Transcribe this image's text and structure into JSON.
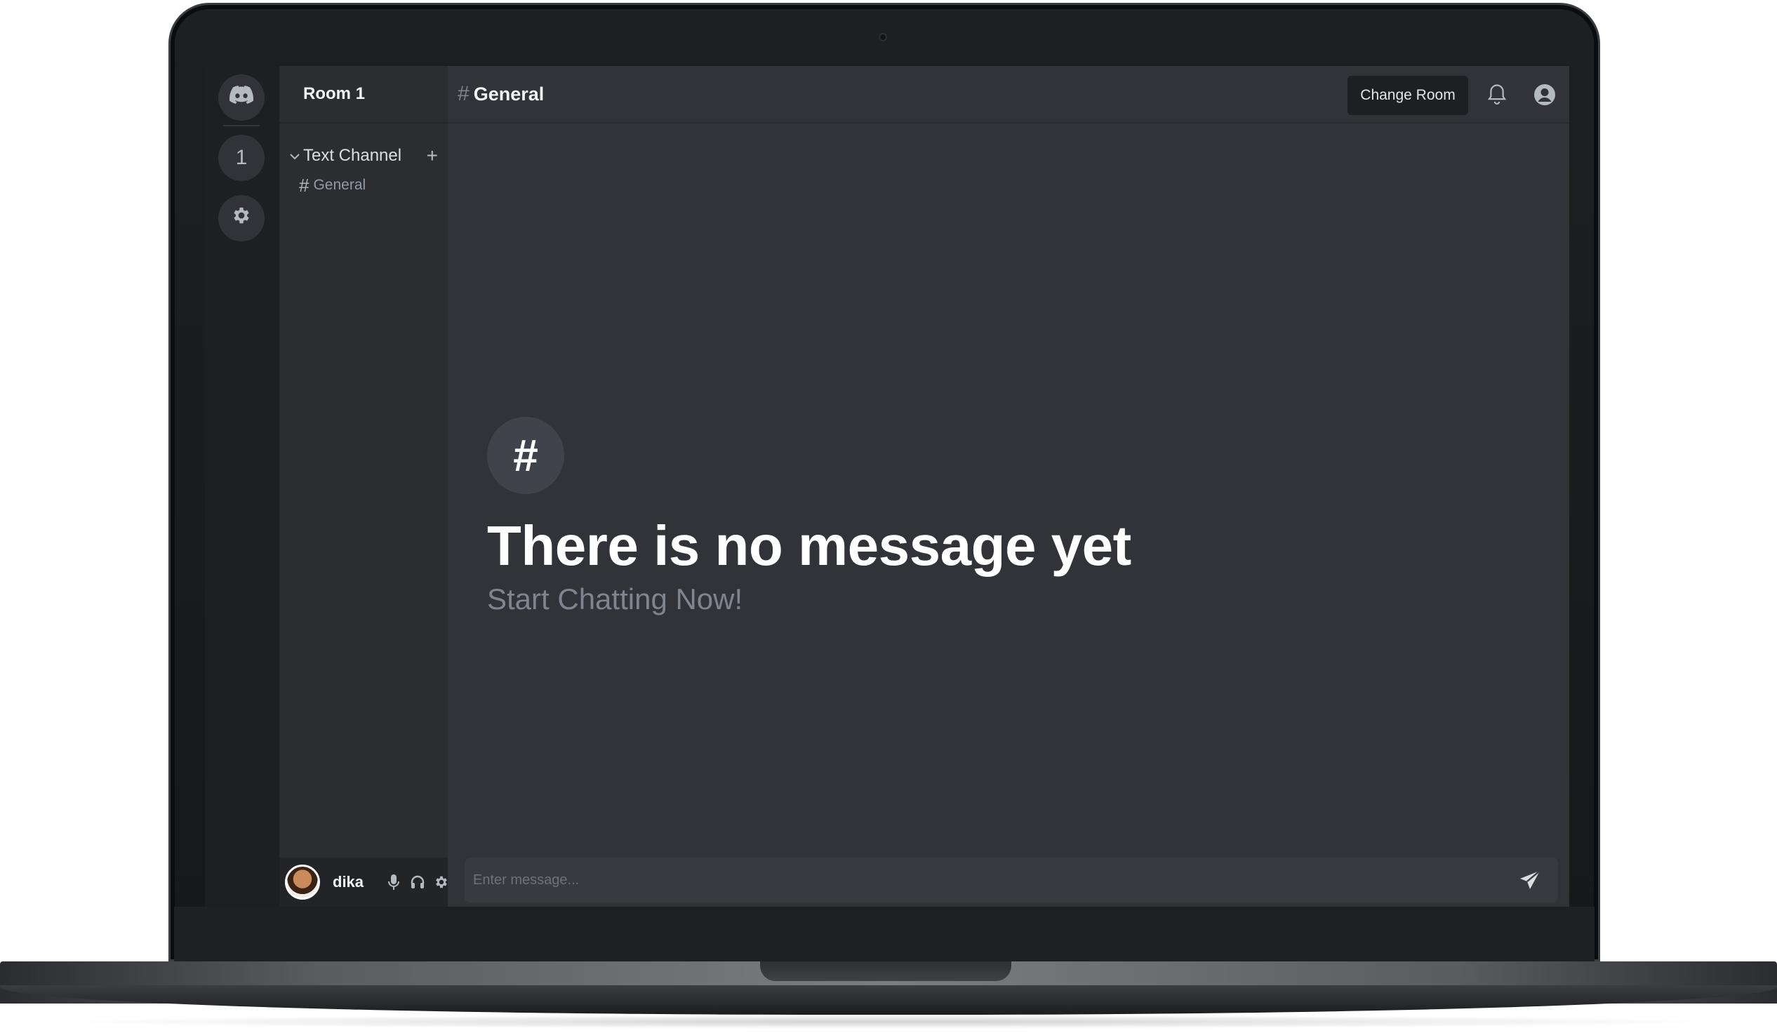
{
  "server_rail": {
    "items": [
      {
        "kind": "home",
        "icon": "discord-logo-icon"
      },
      {
        "kind": "server",
        "label": "1"
      },
      {
        "kind": "settings",
        "icon": "gear-icon"
      }
    ]
  },
  "sidebar": {
    "room_name": "Room 1",
    "category": {
      "label": "Text Channel",
      "add_icon": "+"
    },
    "channels": [
      {
        "hash": "#",
        "label": "General"
      }
    ]
  },
  "user_panel": {
    "username": "dika",
    "icons": [
      "microphone-icon",
      "headphones-icon",
      "gear-icon"
    ]
  },
  "topbar": {
    "hash": "#",
    "channel_title": "General",
    "change_room_label": "Change Room",
    "icons": [
      "bell-icon",
      "user-circle-icon"
    ]
  },
  "empty_state": {
    "hash": "#",
    "title": "There is no message yet",
    "subtitle": "Start Chatting Now!"
  },
  "composer": {
    "placeholder": "Enter message...",
    "value": "",
    "send_icon": "send-icon"
  },
  "colors": {
    "rail_bg": "#1e1f22",
    "sidebar_bg": "#2b2d31",
    "main_bg": "#313338",
    "composer_bg": "#383a40",
    "muted_text": "#80848e",
    "white": "#ffffff"
  }
}
